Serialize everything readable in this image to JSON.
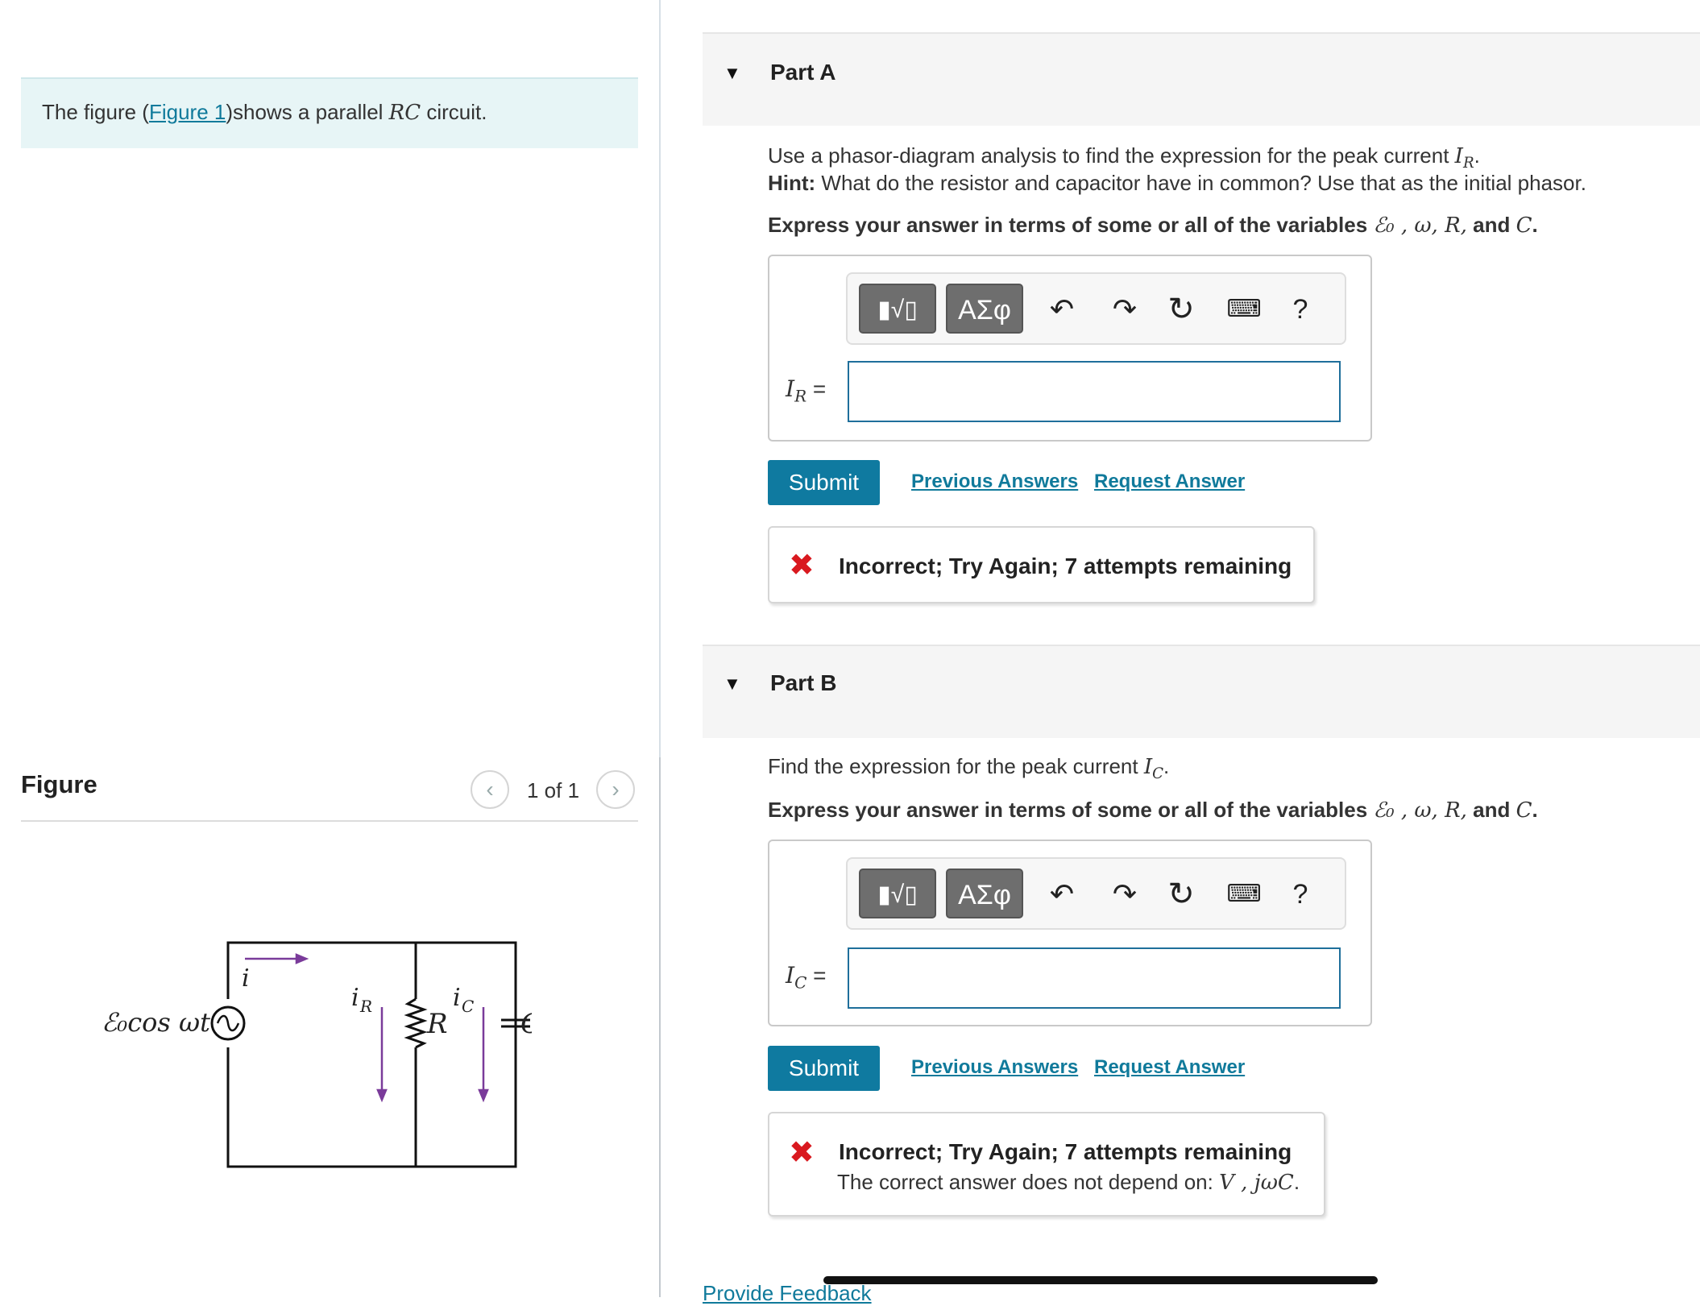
{
  "intro": {
    "prefix": "The figure (",
    "figure_link": "Figure 1",
    "suffix": ")shows a parallel ",
    "rc": "RC",
    "end": " circuit."
  },
  "figure": {
    "title": "Figure",
    "pager": "1 of 1",
    "labels": {
      "source": "ℰ₀cos ωt",
      "i": "i",
      "iR": "i",
      "iR_sub": "R",
      "iC": "i",
      "iC_sub": "C",
      "R": "R",
      "C": "C"
    },
    "colors": {
      "wire": "#111111",
      "arrow": "#7a3b9a"
    }
  },
  "toolbar": {
    "template_label": "▮√▯",
    "symbols_label": "ΑΣφ",
    "undo_icon": "undo-icon",
    "redo_icon": "redo-icon",
    "reset_icon": "reset-icon",
    "keyboard_icon": "keyboard-icon",
    "help_label": "?"
  },
  "partA": {
    "title": "Part A",
    "question": "Use a phasor-diagram analysis to find the expression for the peak current ",
    "question_var": "I",
    "question_sub": "R",
    "hint_label": "Hint:",
    "hint": " What do the resistor and capacitor have in common? Use that as the initial phasor.",
    "express": "Express your answer in terms of some or all of the variables ",
    "vars": "ℰ₀ , ω, R,",
    "and": " and ",
    "last_var": "C",
    "field_var": "I",
    "field_sub": "R",
    "input_value": "",
    "submit": "Submit",
    "prev_answers": "Previous Answers",
    "request_answer": "Request Answer",
    "feedback_title": "Incorrect; Try Again; 7 attempts remaining"
  },
  "partB": {
    "title": "Part B",
    "question": "Find the expression for the peak current ",
    "question_var": "I",
    "question_sub": "C",
    "express": "Express your answer in terms of some or all of the variables ",
    "vars": "ℰ₀ , ω, R,",
    "and": " and ",
    "last_var": "C",
    "field_var": "I",
    "field_sub": "C",
    "input_value": "",
    "submit": "Submit",
    "prev_answers": "Previous Answers",
    "request_answer": "Request Answer",
    "feedback_title": "Incorrect; Try Again; 7 attempts remaining",
    "feedback_detail": "The correct answer does not depend on: ",
    "feedback_vars": "V , jωC"
  },
  "footer": {
    "provide_feedback": "Provide Feedback"
  },
  "colors": {
    "accent": "#0f7aa0",
    "link": "#107a9b",
    "error": "#d9191f",
    "intro_bg": "#e7f5f6"
  }
}
